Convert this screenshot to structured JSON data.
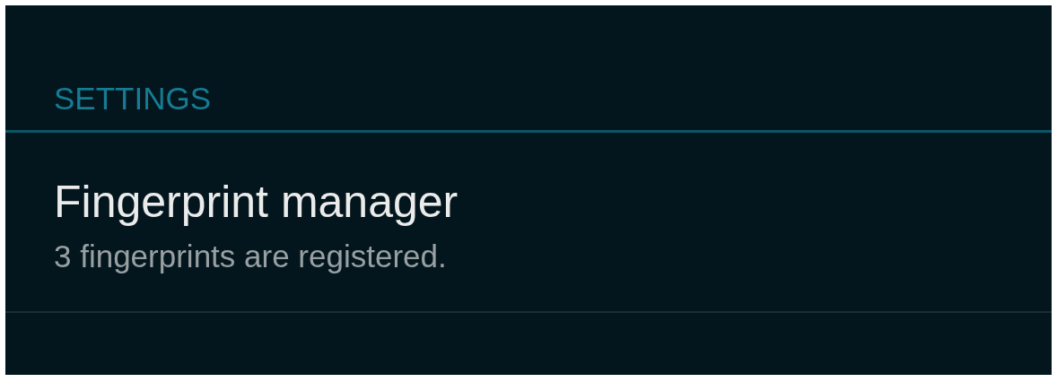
{
  "section_header": "SETTINGS",
  "items": [
    {
      "title": "Fingerprint manager",
      "summary": "3 fingerprints are registered."
    }
  ]
}
